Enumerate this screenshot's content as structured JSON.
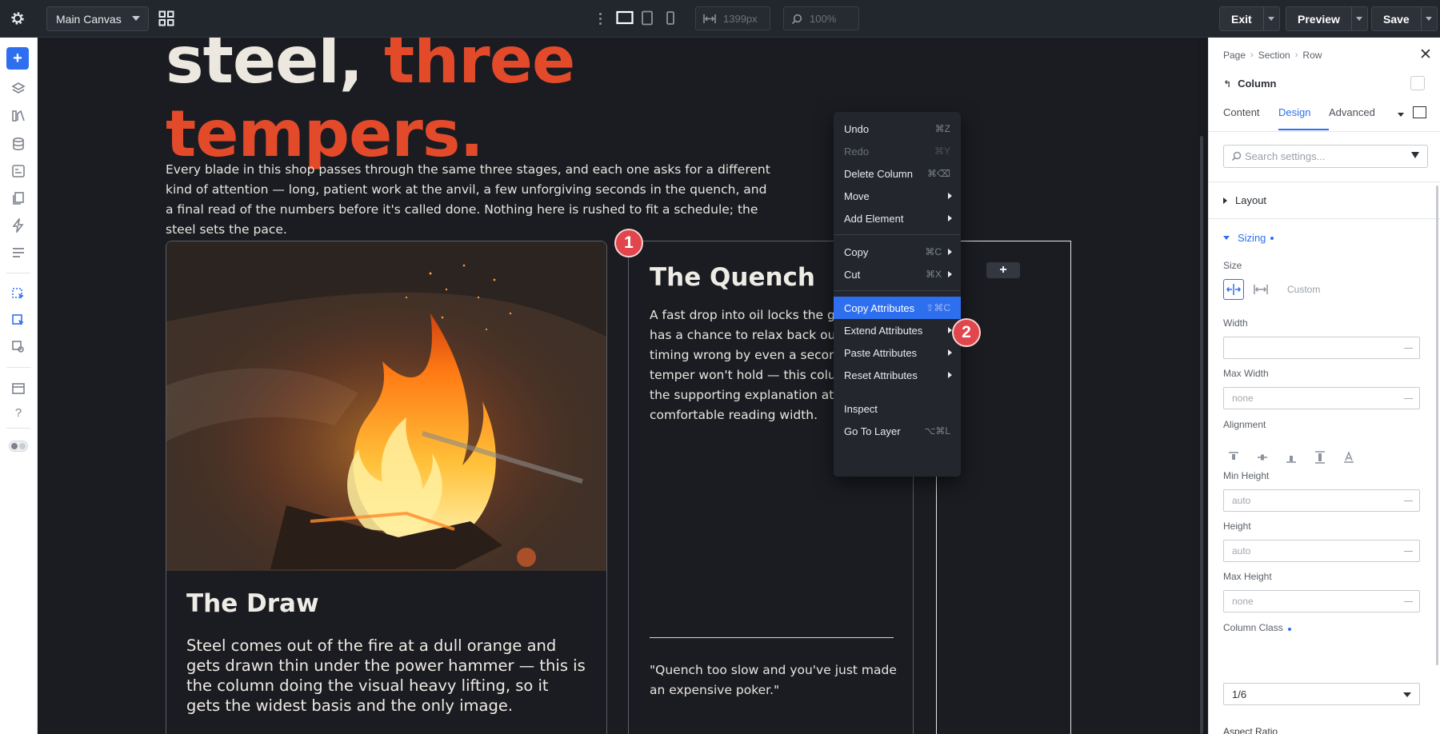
{
  "topbar": {
    "canvas_select": "Main Canvas",
    "width_readout": "1399px",
    "zoom_readout": "100%",
    "exit_label": "Exit",
    "preview_label": "Preview",
    "save_label": "Save"
  },
  "canvas": {
    "hero_line1_a": "steel, ",
    "hero_line1_b": "three",
    "hero_line2": "tempers.",
    "intro": "Every blade in this shop passes through the same three stages, and each one asks for a different kind of attention — long, patient work at the anvil, a few unforgiving seconds in the quench, and a final read of the numbers before it's called done. Nothing here is rushed to fit a schedule; the steel sets the pace.",
    "card_draw": {
      "title": "The Draw",
      "body": "Steel comes out of the fire at a dull orange and gets drawn thin under the power hammer — this is the column doing the visual heavy lifting, so it gets the widest basis and the only image."
    },
    "card_quench": {
      "title": "The Quench",
      "body": "A fast drop into oil locks the grai\nhas a chance to relax back out. G\ntiming wrong by even a second a\ntemper won't hold — this colum\nthe supporting explanation at a\ncomfortable reading width.",
      "quote": "\"Quench too slow and you've just made an expensive poker.\""
    },
    "column_add": "+",
    "step1": "1",
    "step2": "2"
  },
  "context_menu": {
    "items": [
      {
        "label": "Undo",
        "kbd": "⌘Z"
      },
      {
        "label": "Redo",
        "kbd": "⌘Y"
      },
      {
        "label": "Delete Column",
        "kbd": "⌘⌫"
      },
      {
        "label": "Move"
      },
      {
        "label": "Add Element"
      },
      {
        "label": "Copy",
        "kbd": "⌘C"
      },
      {
        "label": "Cut",
        "kbd": "⌘X"
      },
      {
        "label": "Copy Attributes",
        "kbd": "⇧⌘C"
      },
      {
        "label": "Extend Attributes"
      },
      {
        "label": "Paste Attributes"
      },
      {
        "label": "Reset Attributes"
      },
      {
        "label": "Inspect"
      },
      {
        "label": "Go To Layer",
        "kbd": "⌥⌘L"
      }
    ]
  },
  "panel": {
    "breadcrumb": [
      "Page",
      "Section",
      "Row"
    ],
    "element_title": "Column",
    "tabs": [
      "Content",
      "Design",
      "Advanced"
    ],
    "search_placeholder": "Search settings...",
    "sections": {
      "layout": "Layout",
      "sizing": "Sizing"
    },
    "size_label": "Size",
    "size_custom": "Custom",
    "fields": {
      "width": {
        "label": "Width",
        "value": ""
      },
      "max_width": {
        "label": "Max Width",
        "value": "none"
      },
      "alignment": {
        "label": "Alignment"
      },
      "min_height": {
        "label": "Min Height",
        "value": "auto"
      },
      "height": {
        "label": "Height",
        "value": "auto"
      },
      "max_height": {
        "label": "Max Height",
        "value": "none"
      },
      "column_class": {
        "label": "Column Class",
        "value": "1/6"
      },
      "aspect_ratio": {
        "label": "Aspect Ratio"
      }
    }
  },
  "colors": {
    "accent": "#2e6ff0",
    "hero_accent": "#e24a2a",
    "step_badge": "#e0464b"
  }
}
